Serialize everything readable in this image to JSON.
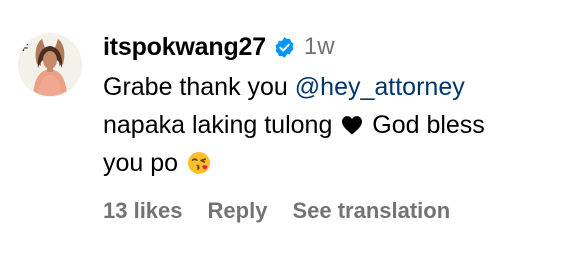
{
  "comment": {
    "username": "itspokwang27",
    "verified_icon": "verified-badge-icon",
    "time": "1w",
    "body": {
      "line1_text": "Grabe thank you ",
      "mention": "@hey_attorney",
      "line2_text": "napaka laking tulong ",
      "heart_icon": "heart-icon",
      "line2_after_heart": " God bless",
      "line3_text": "you po ",
      "emoji_icon": "kissing-face-emoji"
    },
    "likes": "13 likes",
    "reply_label": "Reply",
    "translate_label": "See translation",
    "colors": {
      "verified_badge": "#0095f6",
      "mention": "#00376b",
      "secondary_text": "#737373"
    }
  }
}
